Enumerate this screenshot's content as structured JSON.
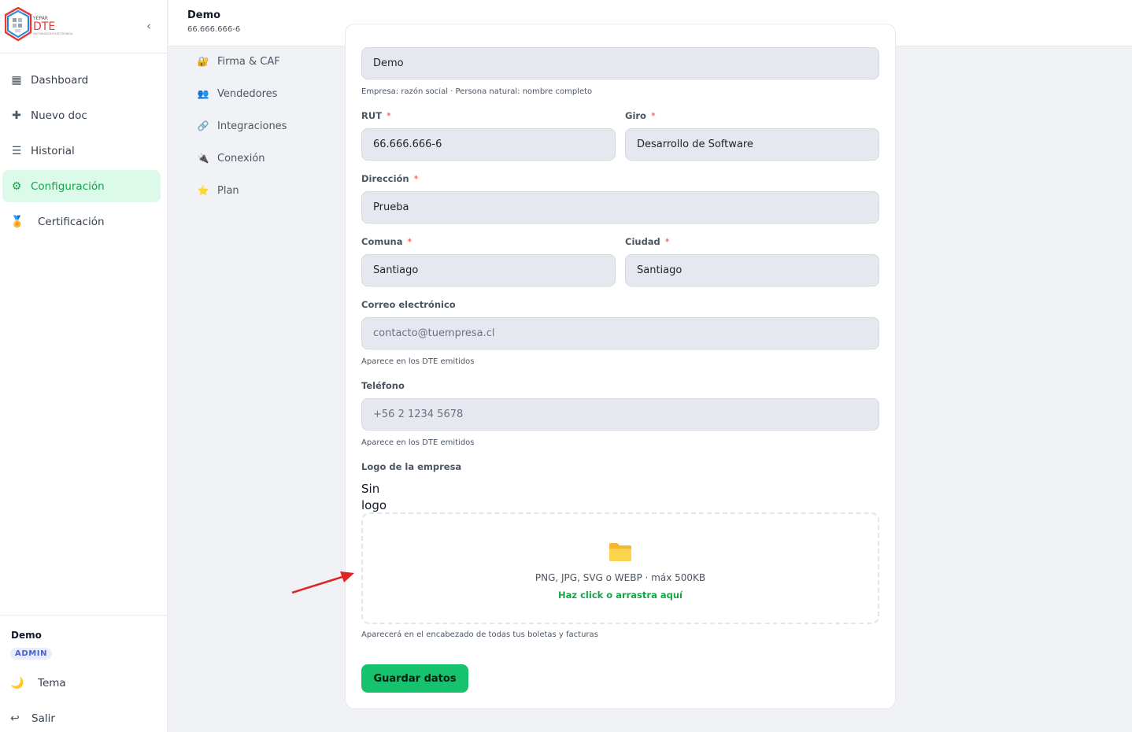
{
  "brand": {
    "logo_small": "YEPAR",
    "logo_main": "DTE",
    "logo_sub": "FACTURACION ELECTRONICA",
    "collapse_icon": "‹"
  },
  "sidebar": {
    "items": [
      {
        "label": "Dashboard",
        "icon": "▦"
      },
      {
        "label": "Nuevo doc",
        "icon": "✚"
      },
      {
        "label": "Historial",
        "icon": "☰"
      },
      {
        "label": "Configuración",
        "icon": "⚙"
      },
      {
        "label": "Certificación",
        "icon": "🏅"
      }
    ],
    "active": "Configuración"
  },
  "footer": {
    "user": "Demo",
    "role": "ADMIN",
    "theme_label": "Tema",
    "theme_icon": "🌙",
    "logout_label": "Salir",
    "logout_icon": "↩"
  },
  "topbar": {
    "company": "Demo",
    "rut": "66.666.666-6"
  },
  "subnav": {
    "items": [
      {
        "label": "Firma & CAF",
        "icon": "🔐"
      },
      {
        "label": "Vendedores",
        "icon": "👥"
      },
      {
        "label": "Integraciones",
        "icon": "🔗"
      },
      {
        "label": "Conexión",
        "icon": "🔌"
      },
      {
        "label": "Plan",
        "icon": "⭐"
      }
    ]
  },
  "form": {
    "razon_social": {
      "value": "Demo",
      "hint": "Empresa: razón social · Persona natural: nombre completo"
    },
    "rut": {
      "label": "RUT",
      "value": "66.666.666-6",
      "required": "*"
    },
    "giro": {
      "label": "Giro",
      "value": "Desarrollo de Software",
      "required": "*"
    },
    "direccion": {
      "label": "Dirección",
      "value": "Prueba",
      "required": "*"
    },
    "comuna": {
      "label": "Comuna",
      "value": "Santiago",
      "required": "*"
    },
    "ciudad": {
      "label": "Ciudad",
      "value": "Santiago",
      "required": "*"
    },
    "correo": {
      "label": "Correo electrónico",
      "placeholder": "contacto@tuempresa.cl",
      "hint": "Aparece en los DTE emitidos"
    },
    "telefono": {
      "label": "Teléfono",
      "placeholder": "+56 2 1234 5678",
      "hint": "Aparece en los DTE emitidos"
    },
    "logo": {
      "label": "Logo de la empresa",
      "none": "Sin logo",
      "drop_text": "PNG, JPG, SVG o WEBP · máx 500KB",
      "drop_link": "Haz click o arrastra aquí",
      "hint": "Aparecerá en el encabezado de todas tus boletas y facturas"
    },
    "save_label": "Guardar datos"
  },
  "colors": {
    "accent": "#17c26e",
    "active_bg": "#dcfae9",
    "active_text": "#16a34a",
    "required": "#ef4444",
    "annotation_arrow": "#e02424"
  }
}
